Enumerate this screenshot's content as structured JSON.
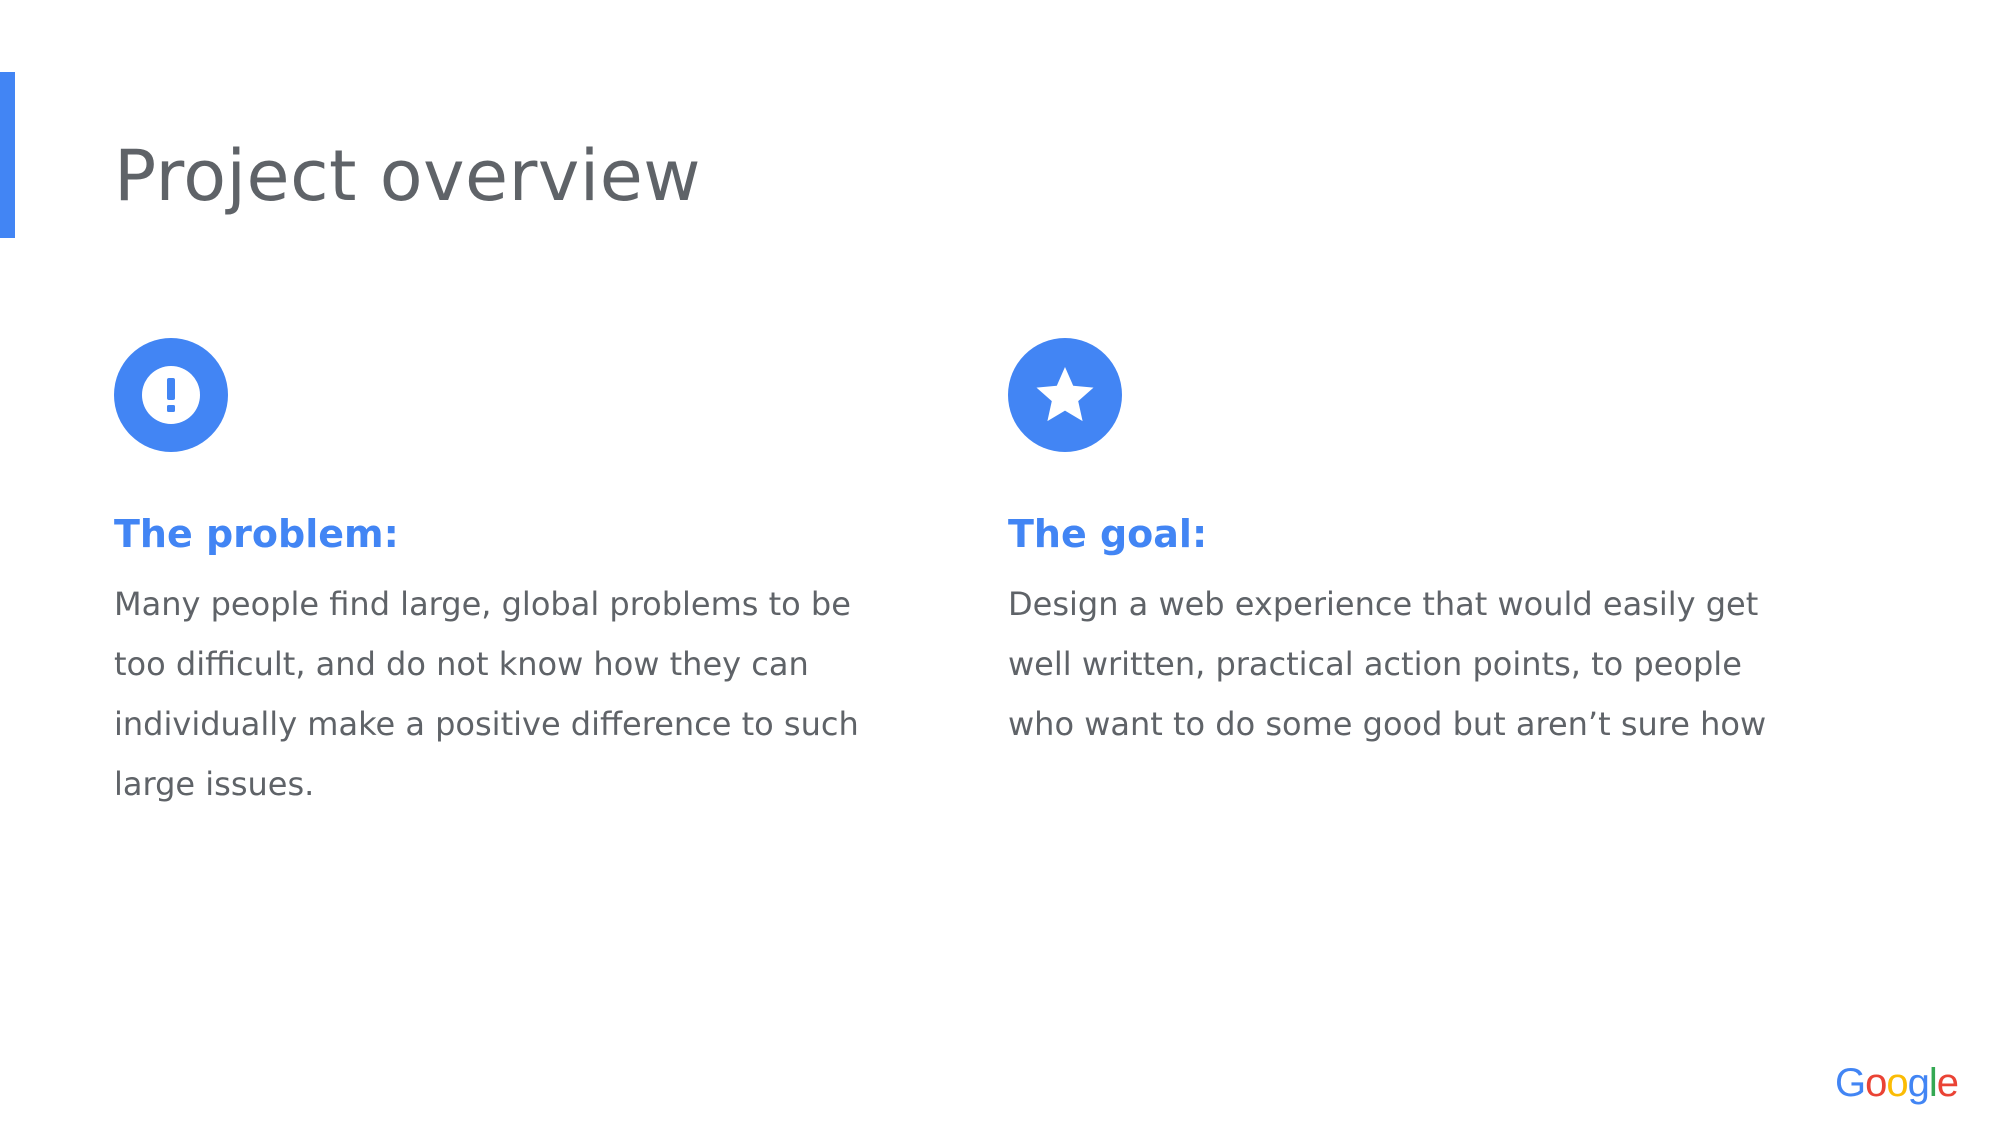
{
  "slide": {
    "title": "Project overview",
    "accent_color": "#4285f4",
    "text_color": "#5f6368"
  },
  "problem": {
    "icon": "alert-circle-icon",
    "heading": "The problem:",
    "lines": [
      "Many people find large, global problems to be",
      "too difficult, and do not know how they can",
      "individually make a positive difference to such",
      "large issues."
    ]
  },
  "goal": {
    "icon": "star-circle-icon",
    "heading": "The goal:",
    "lines": [
      "Design a web experience that would easily get",
      "well written, practical action points, to people",
      "who want to do some good but aren’t sure how"
    ]
  },
  "branding": {
    "logo": "Google",
    "logo_colors": [
      "#4285f4",
      "#ea4335",
      "#fbbc05",
      "#4285f4",
      "#34a853",
      "#ea4335"
    ]
  }
}
